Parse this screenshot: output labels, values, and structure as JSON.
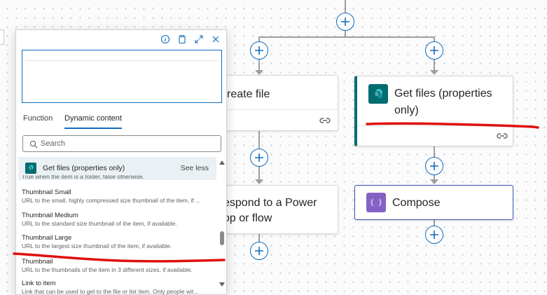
{
  "panel": {
    "tabs": [
      {
        "label": "Function"
      },
      {
        "label": "Dynamic content"
      }
    ],
    "search": {
      "placeholder": "Search"
    },
    "group": {
      "title": "Get files (properties only)",
      "toggle": "See less"
    },
    "partial_top_text": "True when the item is a folder, false otherwise.",
    "items": [
      {
        "name": "Thumbnail Small",
        "description": "URL to the small, highly compressed size thumbnail of the item, if ..."
      },
      {
        "name": "Thumbnail Medium",
        "description": "URL to the standard size thumbnail of the item, if available."
      },
      {
        "name": "Thumbnail Large",
        "description": "URL to the largest size thumbnail of the item, if available."
      },
      {
        "name": "Thumbnail",
        "description": "URL to the thumbnails of the item in 3 different sizes, if available."
      },
      {
        "name": "Link to item",
        "description": "Link that can be used to get to the file or list item. Only people wit..."
      }
    ]
  },
  "cards": {
    "create_file": {
      "title": "reate file"
    },
    "get_files": {
      "title_line1": "Get files (properties",
      "title_line2": "only)"
    },
    "respond": {
      "title_line1": "espond to a Power",
      "title_line2": "pp or flow"
    },
    "compose": {
      "title": "Compose"
    }
  },
  "colors": {
    "accent": "#0f6cbd",
    "sharepoint": "#036c70",
    "compose": "#8661c5",
    "annotation_red": "#e01010"
  },
  "icons": [
    "info-icon",
    "clipboard-icon",
    "expand-icon",
    "close-icon",
    "search-icon",
    "sharepoint-icon",
    "compose-icon",
    "link-icon",
    "add-icon"
  ]
}
